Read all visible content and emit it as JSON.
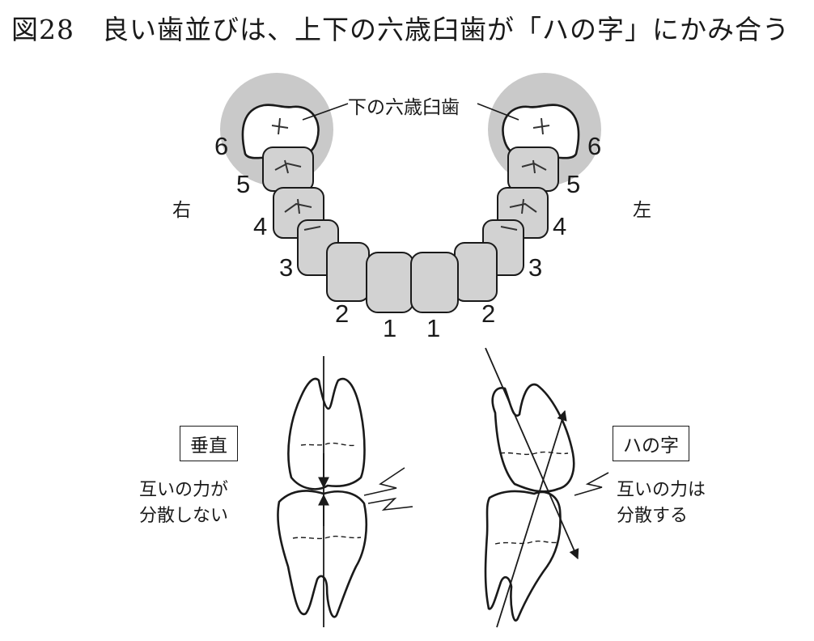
{
  "title": {
    "figure_no": "図28",
    "text": "良い歯並びは、上下の六歳臼歯が「ハの字」にかみ合う"
  },
  "arch": {
    "callout": "下の六歳臼歯",
    "side_right": "右",
    "side_left": "左",
    "numbers_right": [
      "6",
      "5",
      "4",
      "3",
      "2",
      "1"
    ],
    "numbers_left": [
      "6",
      "5",
      "4",
      "3",
      "2",
      "1"
    ]
  },
  "vertical_case": {
    "label": "垂直",
    "note_line1": "互いの力が",
    "note_line2": "分散しない"
  },
  "slant_case": {
    "label": "ハの字",
    "note_line1": "互いの力は",
    "note_line2": "分散する"
  },
  "colors": {
    "tooth_fill": "#d2d2d2",
    "molar_halo": "#c9c9c9",
    "stroke": "#1a1a1a"
  }
}
